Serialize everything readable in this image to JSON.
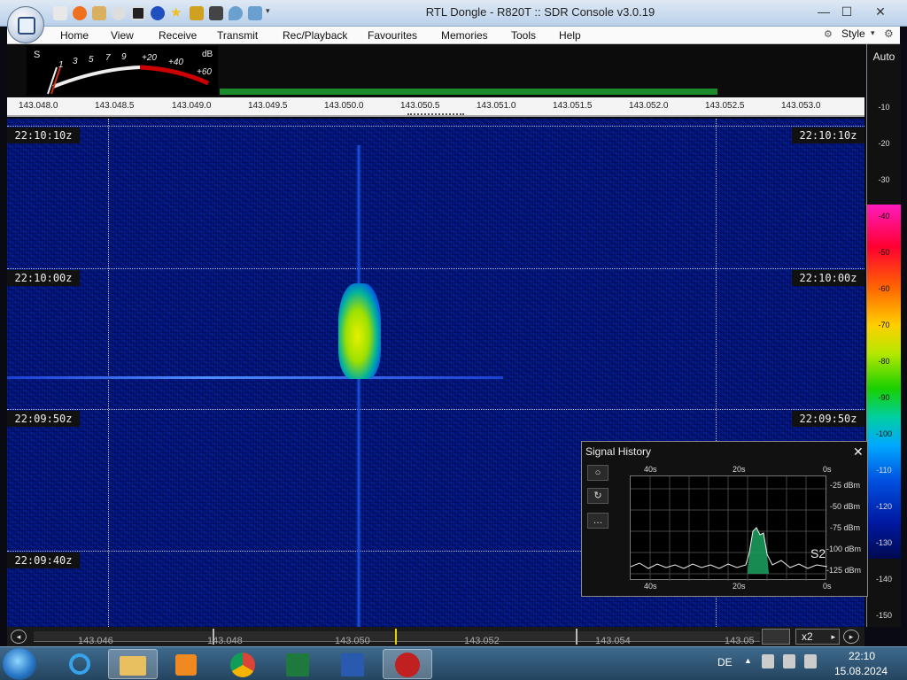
{
  "window": {
    "title": "RTL Dongle - R820T :: SDR Console v3.0.19",
    "controls": {
      "minimize": "—",
      "maximize": "☐",
      "close": "✕"
    }
  },
  "menu": {
    "items": [
      "Home",
      "View",
      "Receive",
      "Transmit",
      "Rec/Playback",
      "Favourites",
      "Memories",
      "Tools",
      "Help"
    ],
    "style_label": "Style"
  },
  "smeter": {
    "s_label": "S",
    "db_label": "dB",
    "ticks": [
      "1",
      "3",
      "5",
      "7",
      "9",
      "+20",
      "+40",
      "+60"
    ]
  },
  "freq_ruler": {
    "ticks": [
      "143.048.0",
      "143.048.5",
      "143.049.0",
      "143.049.5",
      "143.050.0",
      "143.050.5",
      "143.051.0",
      "143.051.5",
      "143.052.0",
      "143.052.5",
      "143.053.0"
    ]
  },
  "waterfall": {
    "timestamps": [
      "22:10:10z",
      "22:10:00z",
      "22:09:50z",
      "22:09:40z"
    ]
  },
  "scale": {
    "auto_label": "Auto",
    "labels": [
      "-10",
      "-20",
      "-30",
      "-40",
      "-50",
      "-60",
      "-70",
      "-80",
      "-90",
      "-100",
      "-110",
      "-120",
      "-130",
      "-140",
      "-150"
    ]
  },
  "signal_history": {
    "title": "Signal History",
    "close": "✕",
    "top_axis": [
      "40s",
      "20s",
      "0s"
    ],
    "bottom_axis": [
      "40s",
      "20s",
      "0s"
    ],
    "y_axis": [
      "-25 dBm",
      "-50 dBm",
      "-75 dBm",
      "-100 dBm",
      "-125 dBm"
    ],
    "s_reading": "S2",
    "buttons": [
      "○",
      "↻",
      "…"
    ]
  },
  "bottom_scroll": {
    "ticks": [
      "143.046",
      "143.048",
      "143.050",
      "143.052",
      "143.054",
      "143.05"
    ],
    "zoom": "x2"
  },
  "taskbar": {
    "lang": "DE",
    "time": "22:10",
    "date": "15.08.2024"
  },
  "colors": {
    "waterfall_bg": "#02106e",
    "accent": "#1b8a2a",
    "signal_yellow": "#e8f000"
  }
}
